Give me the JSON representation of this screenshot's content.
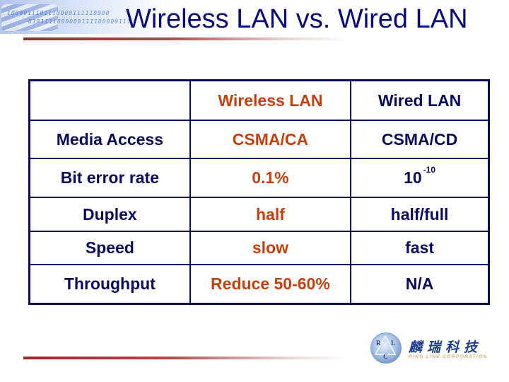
{
  "slide": {
    "title": "Wireless LAN vs. Wired LAN",
    "header_decoration": {
      "binary_line_1": "1000011101110000111110000",
      "binary_line_2": "0101111000000111100000111"
    }
  },
  "table": {
    "columns": [
      "",
      "Wireless LAN",
      "Wired LAN"
    ],
    "rows": [
      {
        "label": "Media Access",
        "wireless": "CSMA/CA",
        "wired": "CSMA/CD"
      },
      {
        "label": "Bit error rate",
        "wireless": "0.1%",
        "wired_base": "10",
        "wired_exponent": "-10"
      },
      {
        "label": "Duplex",
        "wireless": "half",
        "wired": "half/full"
      },
      {
        "label": "Speed",
        "wireless": "slow",
        "wired": "fast"
      },
      {
        "label": "Throughput",
        "wireless": "Reduce 50-60%",
        "wired": "N/A"
      }
    ],
    "colors": {
      "border": "#0a0a5a",
      "label_text": "#0a0a5a",
      "wireless_text": "#c2410f",
      "wired_text": "#0a0a5a"
    }
  },
  "logo": {
    "letters": [
      "R",
      "L",
      "C"
    ],
    "chinese_name": "麟瑞科技",
    "english_name": "RING LINE CORPORATION"
  },
  "colors": {
    "title": "#0a0a7a",
    "rule": "#9a2a2a"
  }
}
